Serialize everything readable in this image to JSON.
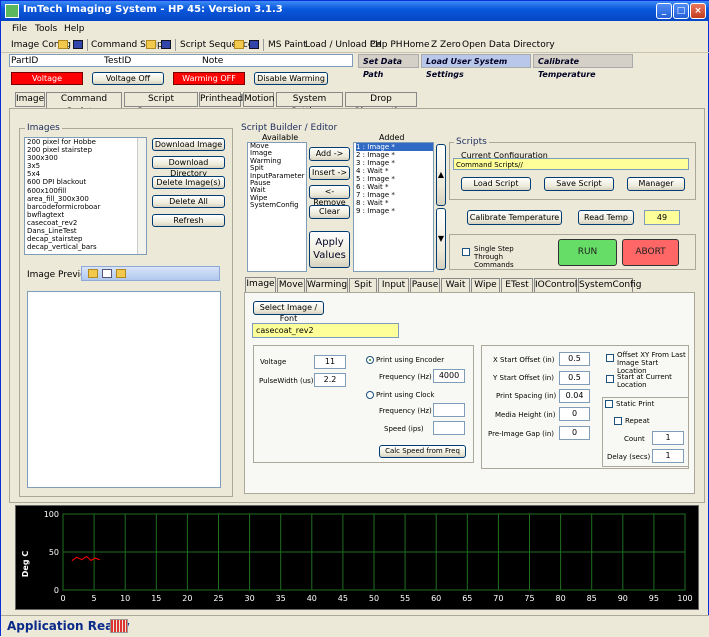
{
  "window": {
    "title": "ImTech Imaging System - HP 45: Version 3.1.3"
  },
  "menu": {
    "file": "File",
    "tools": "Tools",
    "help": "Help"
  },
  "toolbar": {
    "image_config": "Image Config",
    "command_script": "Command Script",
    "script_sequence": "Script Sequence",
    "ms_paint": "MS Paint",
    "load_unload_ph": "Load / Unload PH",
    "cap_ph": "Cap PH",
    "home": "Home",
    "z_zero": "Z Zero",
    "open_data_directory": "Open Data Directory"
  },
  "infobar": {
    "part_id_label": "PartID",
    "test_id_label": "TestID",
    "note_label": "Note",
    "set_data_path": "Set Data Path",
    "load_user_settings": "Load User System Settings",
    "calibrate_temperature": "Calibrate Temperature"
  },
  "status_buttons": {
    "voltage": "Voltage",
    "voltage_off": "Voltage Off",
    "warming_off": "Warming OFF",
    "disable_warming": "Disable Warming"
  },
  "tabs": [
    "Image",
    "Command Scripter",
    "Script Sequencer",
    "Printhead",
    "Motion",
    "System Settings",
    "Drop Observation"
  ],
  "images": {
    "title": "Images",
    "list": [
      "200 pixel for Hobbe",
      "200 pixel stairstep",
      "300x300",
      "3x5",
      "5x4",
      "600 DPI blackout",
      "600x100fill",
      "area_fill_300x300",
      "barcodeformicroboar",
      "bwflagtext",
      "casecoat_rev2",
      "Dans_LineTest",
      "decap_stairstep",
      "decap_vertical_bars"
    ],
    "buttons": [
      "Download Image",
      "Download Directory",
      "Delete Image(s)",
      "Delete All",
      "Refresh"
    ],
    "preview_label": "Image Preview"
  },
  "script_builder": {
    "title": "Script Builder / Editor",
    "available_label": "Available",
    "added_label": "Added",
    "available": [
      "Move",
      "Image",
      "Warming",
      "Spit",
      "InputParameter",
      "Pause",
      "Wait",
      "Wipe",
      "SystemConfig"
    ],
    "added": [
      "1 : Image *",
      "2 : Image *",
      "3 : Image *",
      "4 : Wait *",
      "5 : Image *",
      "6 : Wait *",
      "7 : Image *",
      "8 : Wait *",
      "9 : Image *"
    ],
    "buttons": {
      "add": "Add ->",
      "insert": "Insert ->",
      "remove": "<- Remove",
      "clear": "Clear",
      "apply": "Apply Values"
    }
  },
  "scripts": {
    "title": "Scripts",
    "current_config_label": "Current Configuration",
    "current_config_value": "Command Scripts//",
    "load": "Load Script",
    "save": "Save Script",
    "manager": "Manager",
    "calibrate": "Calibrate Temperature",
    "read_temp": "Read Temp",
    "temp_value": "49",
    "single_step_label": "Single Step Through Commands",
    "run": "RUN",
    "abort": "ABORT"
  },
  "subtabs": [
    "Image",
    "Move",
    "Warming",
    "Spit",
    "Input",
    "Pause",
    "Wait",
    "Wipe",
    "ETest",
    "IOControl",
    "SystemConfig"
  ],
  "image_settings": {
    "select_button": "Select Image / Font",
    "image_name": "casecoat_rev2",
    "voltage_label": "Voltage",
    "voltage": "11",
    "pulsewidth_label": "PulseWidth (us)",
    "pulsewidth": "2.2",
    "encoder_label": "Print using Encoder",
    "frequency_label": "Frequency (Hz)",
    "frequency": "4000",
    "clock_label": "Print using Clock",
    "clock_freq_label": "Frequency (Hz)",
    "clock_freq": "",
    "speed_label": "Speed (ips)",
    "speed": "",
    "calc_button": "Calc Speed from Freq",
    "x_start_label": "X Start Offset (in)",
    "x_start": "0.5",
    "y_start_label": "Y Start Offset (in)",
    "y_start": "0.5",
    "print_spacing_label": "Print Spacing (in)",
    "print_spacing": "0.04",
    "media_height_label": "Media Height (in)",
    "media_height": "0",
    "pre_image_gap_label": "Pre-Image Gap (in)",
    "pre_image_gap": "0",
    "offset_xy_label": "Offset XY From Last Image Start Location",
    "start_current_label": "Start at Current Location",
    "static_print_label": "Static Print",
    "repeat_label": "Repeat",
    "count_label": "Count",
    "count": "1",
    "delay_label": "Delay (secs)",
    "delay": "1"
  },
  "chart_data": {
    "type": "line",
    "ylabel": "Deg C",
    "xlim": [
      0,
      100
    ],
    "ylim": [
      0,
      100
    ],
    "x_ticks": [
      "0",
      "5",
      "10",
      "15",
      "20",
      "25",
      "30",
      "35",
      "40",
      "45",
      "50",
      "55",
      "60",
      "65",
      "70",
      "75",
      "80",
      "85",
      "90",
      "95",
      "100"
    ],
    "y_ticks": [
      "100",
      "50",
      "0"
    ],
    "series": [
      {
        "color": "#ff0000",
        "x": [
          1.5,
          2.2,
          3,
          3.8,
          4.5,
          5.2,
          5.8
        ],
        "y": [
          39,
          43,
          40,
          44,
          39,
          42,
          40
        ]
      }
    ],
    "grid": true
  },
  "status": {
    "text": "Application Ready"
  },
  "colors": {
    "run": "#66dd66",
    "abort": "#ff6666",
    "chart_bg": "#000000",
    "grid": "#1f6f1f",
    "line": "#ff0000"
  }
}
